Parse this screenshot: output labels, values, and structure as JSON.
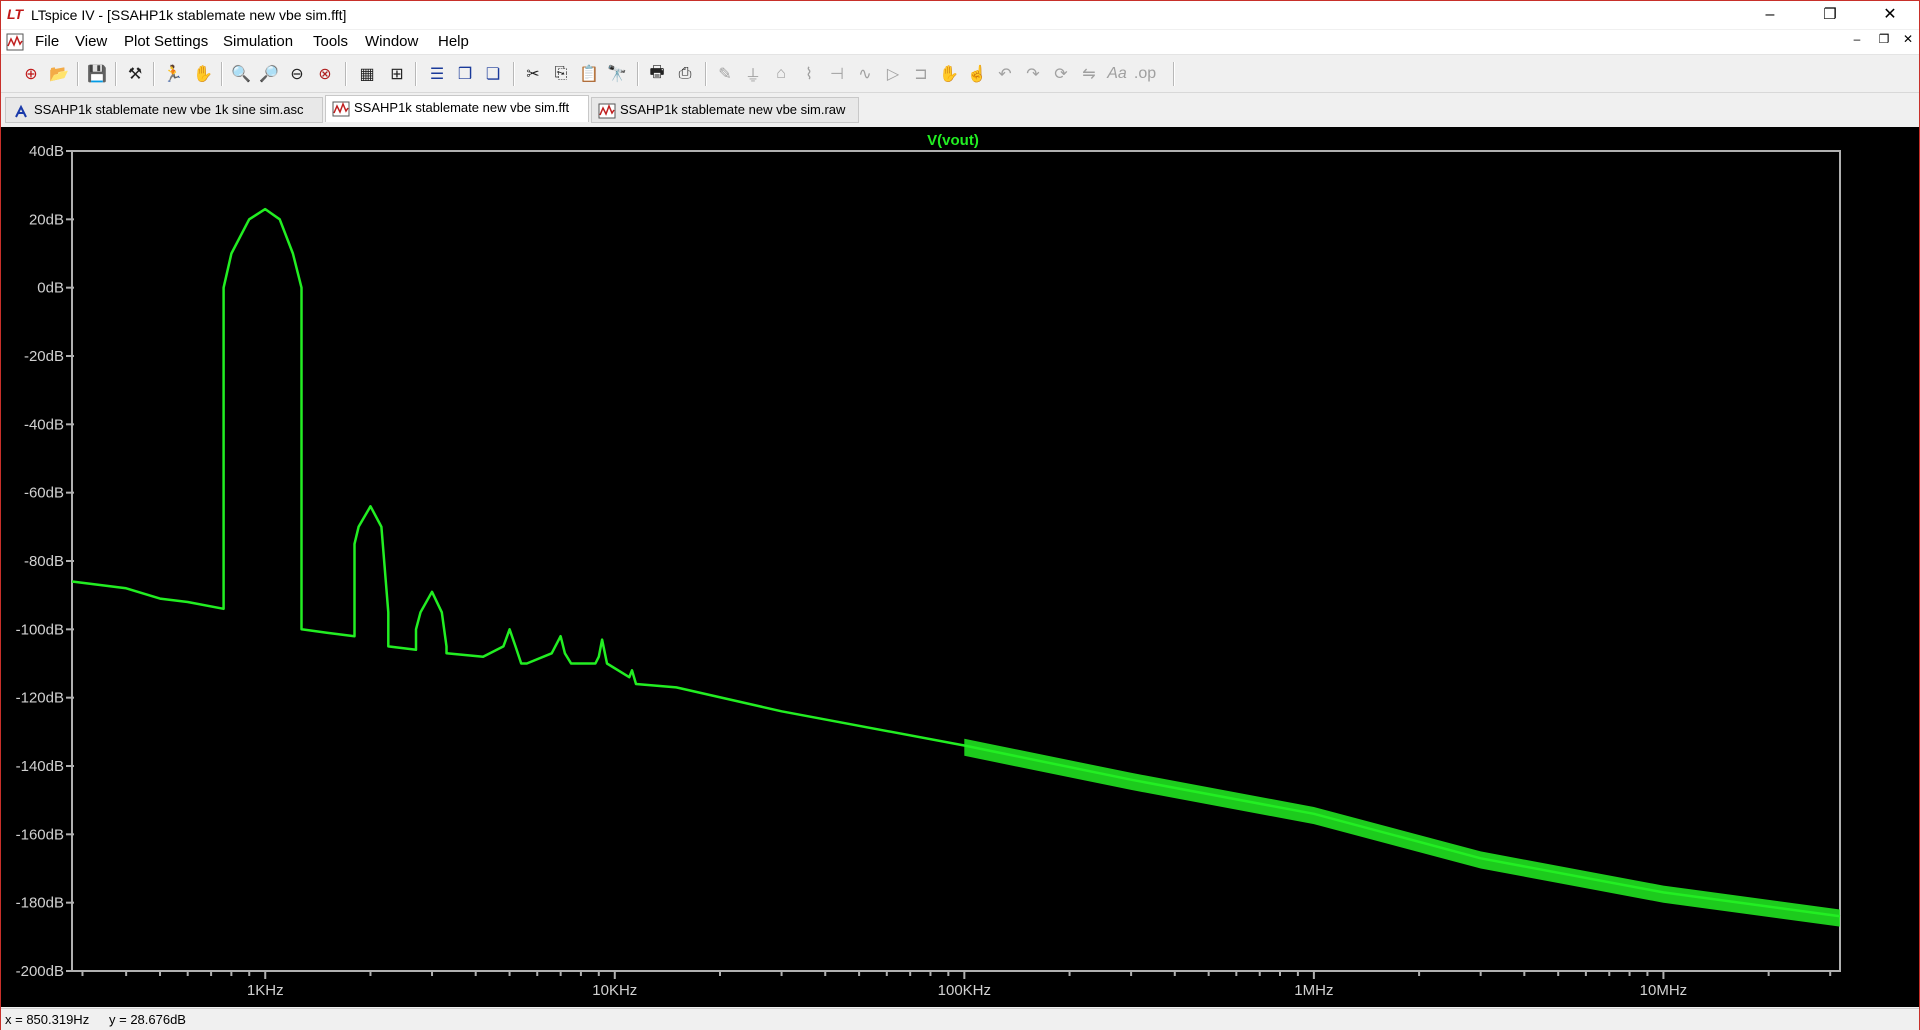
{
  "window": {
    "title": "LTspice IV - [SSAHP1k stablemate new vbe sim.fft]",
    "logo_text": "LT",
    "controls": {
      "minimize": "–",
      "restore": "❐",
      "close": "✕"
    }
  },
  "menu": {
    "items": [
      "File",
      "View",
      "Plot Settings",
      "Simulation",
      "Tools",
      "Window",
      "Help"
    ],
    "mdi_controls": {
      "minimize": "–",
      "restore": "❐",
      "close": "✕"
    }
  },
  "toolbar": {
    "icons": [
      "new-schematic-icon",
      "open-icon",
      "save-icon",
      "control-panel-icon",
      "run-icon",
      "halt-icon",
      "zoom-in-icon",
      "zoom-out-icon",
      "zoom-back-icon",
      "zoom-cancel-icon",
      "autorange-icon",
      "mark-unzoom-icon",
      "tile-horizontal-icon",
      "cascade-icon",
      "tile-vertical-icon",
      "cut-icon",
      "copy-icon",
      "paste-icon",
      "find-icon",
      "print-preview-icon",
      "print-icon",
      "draw-wire-icon",
      "ground-icon",
      "label-net-icon",
      "resistor-icon",
      "capacitor-icon",
      "inductor-icon",
      "diode-icon",
      "component-icon",
      "move-icon",
      "drag-icon",
      "undo-icon",
      "redo-icon",
      "rotate-icon",
      "mirror-icon",
      "text-icon",
      "spice-directive-icon"
    ]
  },
  "tabs": [
    {
      "label": "SSAHP1k stablemate new vbe 1k sine sim.asc",
      "icon": "schematic-icon",
      "active": false
    },
    {
      "label": "SSAHP1k stablemate new vbe sim.fft",
      "icon": "waveform-icon",
      "active": true
    },
    {
      "label": "SSAHP1k stablemate new vbe sim.raw",
      "icon": "waveform-icon",
      "active": false
    }
  ],
  "status": {
    "x_readout": "x = 850.319Hz",
    "y_readout": "y = 28.676dB"
  },
  "chart_data": {
    "type": "line",
    "title": "V(vout)",
    "trace_color": "#22ee22",
    "x_scale": "log",
    "xlim": [
      280,
      32000000
    ],
    "ylim": [
      -200,
      40
    ],
    "y_ticks": [
      {
        "v": 40,
        "label": "40dB"
      },
      {
        "v": 20,
        "label": "20dB"
      },
      {
        "v": 0,
        "label": "0dB"
      },
      {
        "v": -20,
        "label": "-20dB"
      },
      {
        "v": -40,
        "label": "-40dB"
      },
      {
        "v": -60,
        "label": "-60dB"
      },
      {
        "v": -80,
        "label": "-80dB"
      },
      {
        "v": -100,
        "label": "-100dB"
      },
      {
        "v": -120,
        "label": "-120dB"
      },
      {
        "v": -140,
        "label": "-140dB"
      },
      {
        "v": -160,
        "label": "-160dB"
      },
      {
        "v": -180,
        "label": "-180dB"
      },
      {
        "v": -200,
        "label": "-200dB"
      }
    ],
    "x_ticks": [
      {
        "v": 1000,
        "label": "1KHz"
      },
      {
        "v": 10000,
        "label": "10KHz"
      },
      {
        "v": 100000,
        "label": "100KHz"
      },
      {
        "v": 1000000,
        "label": "1MHz"
      },
      {
        "v": 10000000,
        "label": "10MHz"
      }
    ],
    "series": [
      {
        "x": [
          280,
          400,
          500,
          600,
          760,
          760,
          800,
          900,
          1000,
          1100,
          1200,
          1270,
          1270,
          1500,
          1800,
          1800,
          1850,
          2000,
          2150,
          2250,
          2250,
          2700,
          2700,
          2780,
          3000,
          3200,
          3300,
          3300,
          4200,
          4800,
          5000,
          5200,
          5400,
          5600,
          6600,
          7000,
          7200,
          7500,
          8800,
          9000,
          9200,
          9500,
          11000,
          11200,
          11500,
          15000,
          30000,
          100000,
          300000,
          1000000,
          3000000,
          10000000,
          32000000
        ],
        "y": [
          -86,
          -88,
          -91,
          -92,
          -94,
          0,
          10,
          20,
          23,
          20,
          10,
          0,
          -100,
          -101,
          -102,
          -75,
          -70,
          -64,
          -70,
          -95,
          -105,
          -106,
          -100,
          -95,
          -89,
          -95,
          -105,
          -107,
          -108,
          -105,
          -100,
          -105,
          -110,
          -110,
          -107,
          -102,
          -107,
          -110,
          -110,
          -108,
          -103,
          -110,
          -114,
          -112,
          -116,
          -117,
          -124,
          -134,
          -144,
          -154,
          -167,
          -177,
          -184
        ]
      }
    ]
  }
}
